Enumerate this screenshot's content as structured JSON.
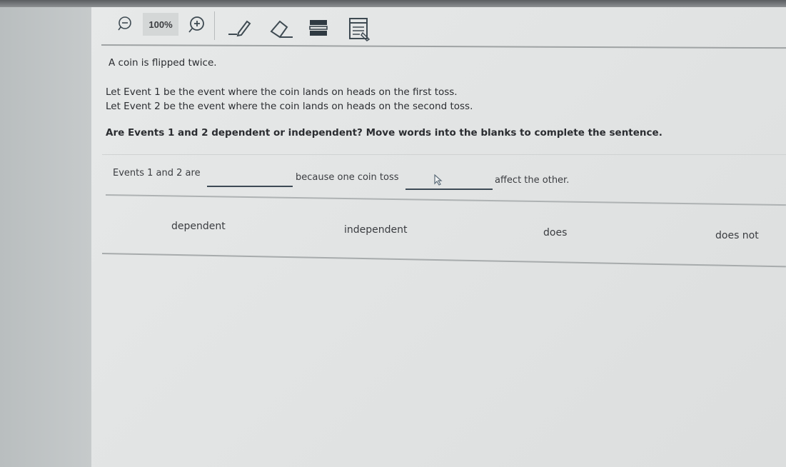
{
  "toolbar": {
    "zoom_level": "100%",
    "icons": [
      "zoom-out-icon",
      "zoom-in-icon",
      "pen-icon",
      "eraser-icon",
      "line-reader-icon",
      "notepad-icon"
    ]
  },
  "question": {
    "intro": "A coin is flipped twice.",
    "event1": "Let Event 1 be the event where the coin lands on heads on the first toss.",
    "event2": "Let Event 2 be the event where the coin lands on heads on the second toss.",
    "prompt": "Are Events 1 and 2 dependent or independent? Move words into the blanks to complete the sentence."
  },
  "sentence": {
    "part1": "Events 1 and 2 are",
    "part2": "because one coin toss",
    "part3": "affect the other."
  },
  "word_bank": [
    "dependent",
    "independent",
    "does",
    "does not"
  ],
  "colors": {
    "page_background": "#e4e6e6",
    "text": "#2b2d31",
    "blank_underline": "#3d4a55"
  }
}
